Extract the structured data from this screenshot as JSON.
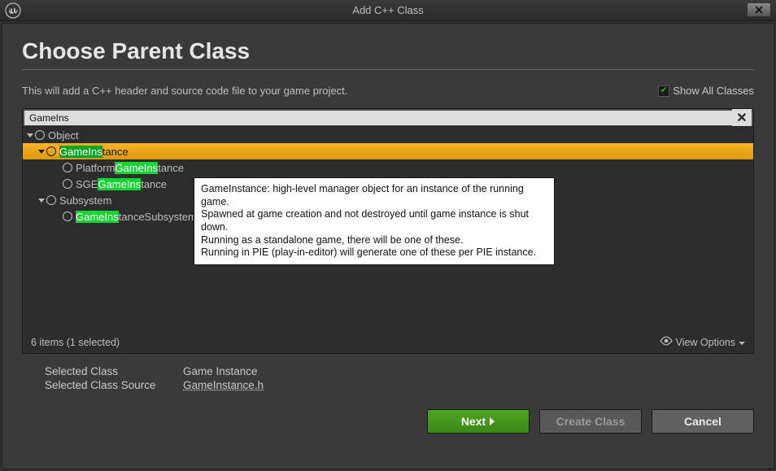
{
  "window": {
    "title": "Add C++ Class"
  },
  "header": {
    "title": "Choose Parent Class",
    "subtitle": "This will add a C++ header and source code file to your game project.",
    "show_all_label": "Show All Classes"
  },
  "tree": {
    "search_value": "GameIns",
    "items": [
      {
        "level": 1,
        "name": "Object",
        "expanded": true,
        "has_children": true
      },
      {
        "level": 2,
        "name_parts": [
          "",
          "GameIns",
          "tance"
        ],
        "expanded": true,
        "has_children": true,
        "selected": true
      },
      {
        "level": 3,
        "name_parts": [
          "Platform",
          "GameIns",
          "tance"
        ],
        "has_children": false
      },
      {
        "level": 3,
        "name_parts": [
          "SGE",
          "GameIns",
          "tance"
        ],
        "has_children": false
      },
      {
        "level": 2,
        "name": "Subsystem",
        "expanded": true,
        "has_children": true
      },
      {
        "level": 3,
        "name_parts": [
          "",
          "GameIns",
          "tanceSubsystem"
        ],
        "has_children": false
      }
    ],
    "status": "6 items (1 selected)",
    "view_options": "View Options"
  },
  "tooltip": {
    "line1": "GameInstance: high-level manager object for an instance of the running game.",
    "line2": "Spawned at game creation and not destroyed until game instance is shut down.",
    "line3": "Running as a standalone game, there will be one of these.",
    "line4": "Running in PIE (play-in-editor) will generate one of these per PIE instance."
  },
  "selected": {
    "label_class": "Selected Class",
    "label_source": "Selected Class Source",
    "value_class": "Game Instance",
    "value_source": "GameInstance.h"
  },
  "buttons": {
    "next": "Next",
    "create": "Create Class",
    "cancel": "Cancel"
  }
}
